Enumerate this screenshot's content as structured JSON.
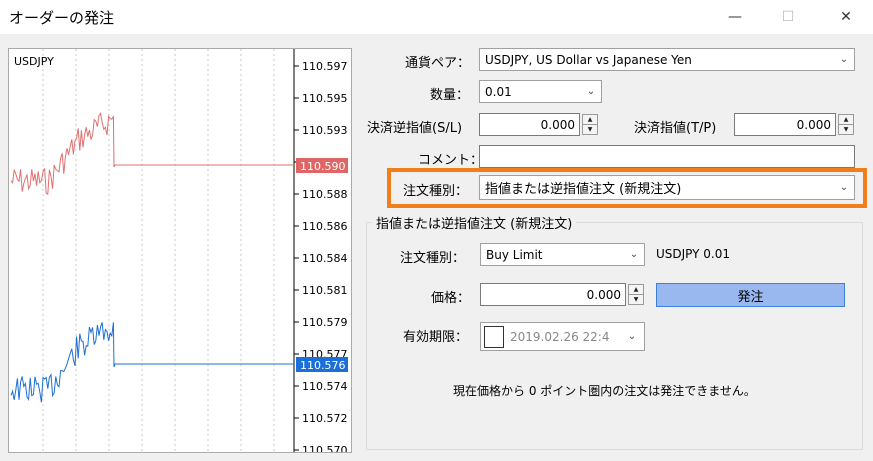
{
  "window": {
    "title": "オーダーの発注",
    "minimize_icon": "minimize-icon",
    "maximize_icon": "maximize-icon",
    "close_icon": "close-icon"
  },
  "chart": {
    "symbol": "USDJPY",
    "price_ticks": [
      "110.597",
      "110.595",
      "110.593",
      "110.590",
      "110.588",
      "110.586",
      "110.584",
      "110.581",
      "110.579",
      "110.577",
      "110.574",
      "110.572",
      "110.570"
    ],
    "ask_tag": "110.590",
    "bid_tag": "110.576",
    "colors": {
      "ask": "#e07070",
      "bid": "#1f6fd0",
      "ask_tag_bg": "#e06666",
      "bid_tag_bg": "#1a6fd8"
    }
  },
  "form": {
    "symbol": {
      "label": "通貨ペア：",
      "value": "USDJPY, US Dollar vs Japanese Yen"
    },
    "volume": {
      "label": "数量：",
      "value": "0.01"
    },
    "stop_loss": {
      "label": "決済逆指値(S/L)",
      "value": "0.000"
    },
    "take_profit": {
      "label": "決済指値(T/P)",
      "value": "0.000"
    },
    "comment": {
      "label": "コメント：",
      "value": ""
    },
    "order_type": {
      "label": "注文種別：",
      "value": "指値または逆指値注文 (新規注文)"
    }
  },
  "group": {
    "title": "指値または逆指値注文 (新規注文)",
    "type": {
      "label": "注文種別：",
      "value": "Buy Limit"
    },
    "summary": "USDJPY 0.01",
    "price": {
      "label": "価格：",
      "value": "0.000"
    },
    "send_label": "発注",
    "expiry": {
      "label": "有効期限：",
      "value": "2019.02.26 22:4"
    },
    "message": "現在価格から 0 ポイント圏内の注文は発注できません。"
  },
  "colors": {
    "highlight": "#f07f1a",
    "send_button": "#99b8f0"
  }
}
